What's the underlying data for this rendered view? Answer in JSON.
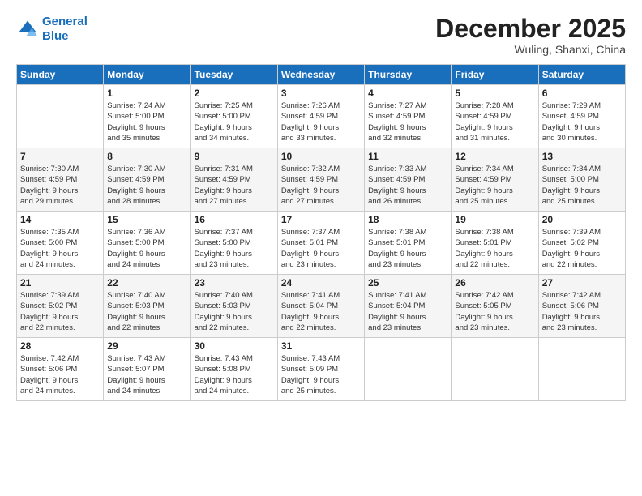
{
  "header": {
    "logo_line1": "General",
    "logo_line2": "Blue",
    "month": "December 2025",
    "location": "Wuling, Shanxi, China"
  },
  "days_of_week": [
    "Sunday",
    "Monday",
    "Tuesday",
    "Wednesday",
    "Thursday",
    "Friday",
    "Saturday"
  ],
  "weeks": [
    [
      {
        "day": "",
        "content": ""
      },
      {
        "day": "1",
        "content": "Sunrise: 7:24 AM\nSunset: 5:00 PM\nDaylight: 9 hours\nand 35 minutes."
      },
      {
        "day": "2",
        "content": "Sunrise: 7:25 AM\nSunset: 5:00 PM\nDaylight: 9 hours\nand 34 minutes."
      },
      {
        "day": "3",
        "content": "Sunrise: 7:26 AM\nSunset: 4:59 PM\nDaylight: 9 hours\nand 33 minutes."
      },
      {
        "day": "4",
        "content": "Sunrise: 7:27 AM\nSunset: 4:59 PM\nDaylight: 9 hours\nand 32 minutes."
      },
      {
        "day": "5",
        "content": "Sunrise: 7:28 AM\nSunset: 4:59 PM\nDaylight: 9 hours\nand 31 minutes."
      },
      {
        "day": "6",
        "content": "Sunrise: 7:29 AM\nSunset: 4:59 PM\nDaylight: 9 hours\nand 30 minutes."
      }
    ],
    [
      {
        "day": "7",
        "content": "Sunrise: 7:30 AM\nSunset: 4:59 PM\nDaylight: 9 hours\nand 29 minutes."
      },
      {
        "day": "8",
        "content": "Sunrise: 7:30 AM\nSunset: 4:59 PM\nDaylight: 9 hours\nand 28 minutes."
      },
      {
        "day": "9",
        "content": "Sunrise: 7:31 AM\nSunset: 4:59 PM\nDaylight: 9 hours\nand 27 minutes."
      },
      {
        "day": "10",
        "content": "Sunrise: 7:32 AM\nSunset: 4:59 PM\nDaylight: 9 hours\nand 27 minutes."
      },
      {
        "day": "11",
        "content": "Sunrise: 7:33 AM\nSunset: 4:59 PM\nDaylight: 9 hours\nand 26 minutes."
      },
      {
        "day": "12",
        "content": "Sunrise: 7:34 AM\nSunset: 4:59 PM\nDaylight: 9 hours\nand 25 minutes."
      },
      {
        "day": "13",
        "content": "Sunrise: 7:34 AM\nSunset: 5:00 PM\nDaylight: 9 hours\nand 25 minutes."
      }
    ],
    [
      {
        "day": "14",
        "content": "Sunrise: 7:35 AM\nSunset: 5:00 PM\nDaylight: 9 hours\nand 24 minutes."
      },
      {
        "day": "15",
        "content": "Sunrise: 7:36 AM\nSunset: 5:00 PM\nDaylight: 9 hours\nand 24 minutes."
      },
      {
        "day": "16",
        "content": "Sunrise: 7:37 AM\nSunset: 5:00 PM\nDaylight: 9 hours\nand 23 minutes."
      },
      {
        "day": "17",
        "content": "Sunrise: 7:37 AM\nSunset: 5:01 PM\nDaylight: 9 hours\nand 23 minutes."
      },
      {
        "day": "18",
        "content": "Sunrise: 7:38 AM\nSunset: 5:01 PM\nDaylight: 9 hours\nand 23 minutes."
      },
      {
        "day": "19",
        "content": "Sunrise: 7:38 AM\nSunset: 5:01 PM\nDaylight: 9 hours\nand 22 minutes."
      },
      {
        "day": "20",
        "content": "Sunrise: 7:39 AM\nSunset: 5:02 PM\nDaylight: 9 hours\nand 22 minutes."
      }
    ],
    [
      {
        "day": "21",
        "content": "Sunrise: 7:39 AM\nSunset: 5:02 PM\nDaylight: 9 hours\nand 22 minutes."
      },
      {
        "day": "22",
        "content": "Sunrise: 7:40 AM\nSunset: 5:03 PM\nDaylight: 9 hours\nand 22 minutes."
      },
      {
        "day": "23",
        "content": "Sunrise: 7:40 AM\nSunset: 5:03 PM\nDaylight: 9 hours\nand 22 minutes."
      },
      {
        "day": "24",
        "content": "Sunrise: 7:41 AM\nSunset: 5:04 PM\nDaylight: 9 hours\nand 22 minutes."
      },
      {
        "day": "25",
        "content": "Sunrise: 7:41 AM\nSunset: 5:04 PM\nDaylight: 9 hours\nand 23 minutes."
      },
      {
        "day": "26",
        "content": "Sunrise: 7:42 AM\nSunset: 5:05 PM\nDaylight: 9 hours\nand 23 minutes."
      },
      {
        "day": "27",
        "content": "Sunrise: 7:42 AM\nSunset: 5:06 PM\nDaylight: 9 hours\nand 23 minutes."
      }
    ],
    [
      {
        "day": "28",
        "content": "Sunrise: 7:42 AM\nSunset: 5:06 PM\nDaylight: 9 hours\nand 24 minutes."
      },
      {
        "day": "29",
        "content": "Sunrise: 7:43 AM\nSunset: 5:07 PM\nDaylight: 9 hours\nand 24 minutes."
      },
      {
        "day": "30",
        "content": "Sunrise: 7:43 AM\nSunset: 5:08 PM\nDaylight: 9 hours\nand 24 minutes."
      },
      {
        "day": "31",
        "content": "Sunrise: 7:43 AM\nSunset: 5:09 PM\nDaylight: 9 hours\nand 25 minutes."
      },
      {
        "day": "",
        "content": ""
      },
      {
        "day": "",
        "content": ""
      },
      {
        "day": "",
        "content": ""
      }
    ]
  ]
}
